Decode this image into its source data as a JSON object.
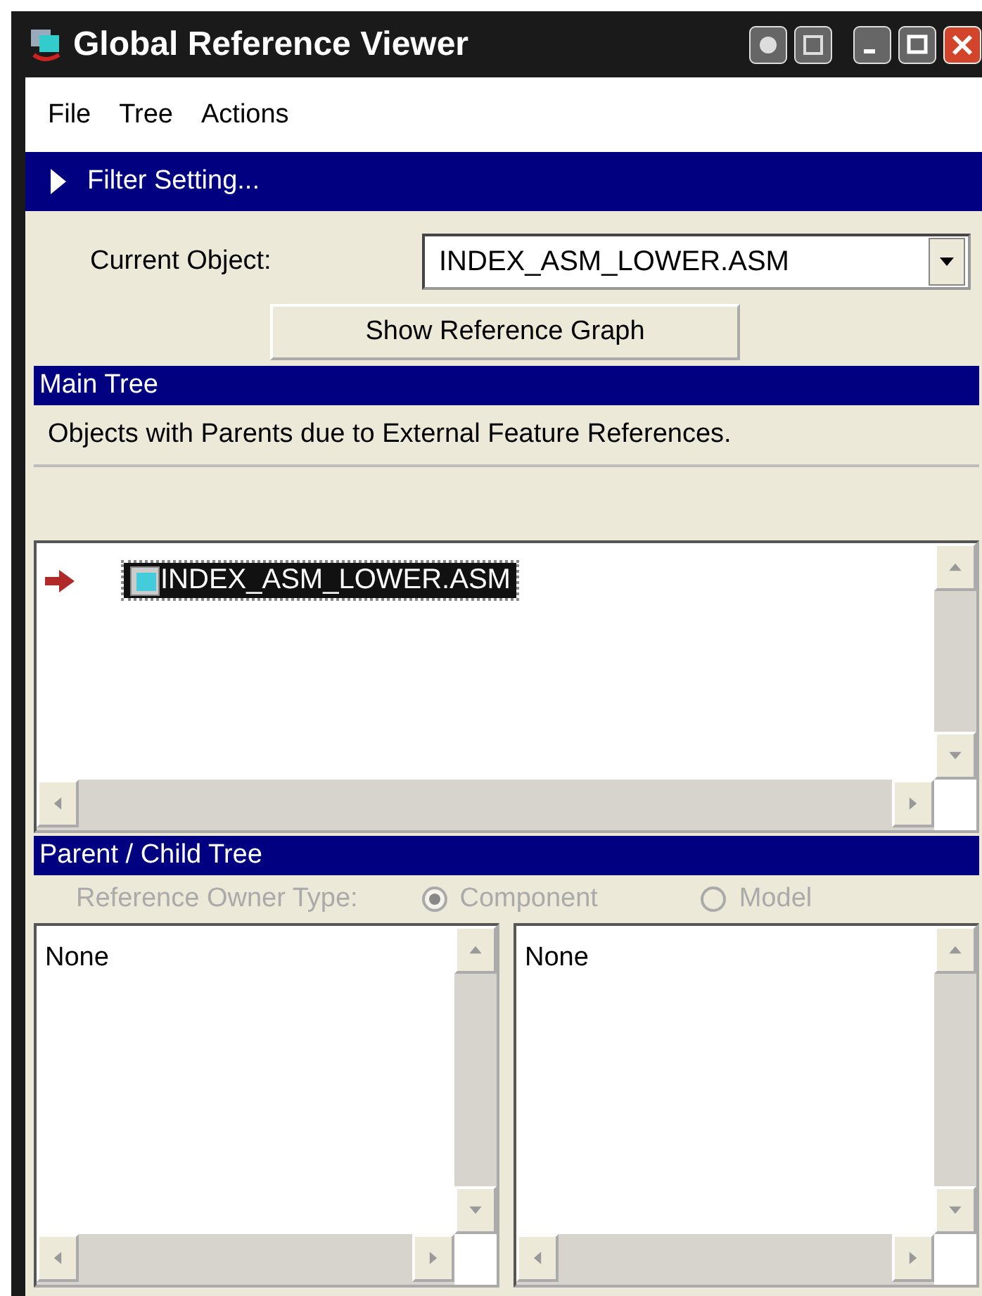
{
  "window": {
    "title": "Global Reference Viewer"
  },
  "menu": [
    "File",
    "Tree",
    "Actions"
  ],
  "filter_bar": {
    "label": "Filter Setting...",
    "expanded": false
  },
  "current_object": {
    "label": "Current Object:",
    "value": "INDEX_ASM_LOWER.ASM"
  },
  "show_graph_button": "Show Reference Graph",
  "main_tree": {
    "title": "Main Tree",
    "description": "Objects with Parents due to External Feature References.",
    "items": [
      {
        "label": "INDEX_ASM_LOWER.ASM",
        "selected": true
      }
    ]
  },
  "parent_child_tree": {
    "title": "Parent / Child Tree",
    "owner_type": {
      "label": "Reference Owner Type:",
      "disabled": true,
      "options": [
        {
          "label": "Component",
          "selected": true
        },
        {
          "label": "Model",
          "selected": false
        }
      ]
    },
    "lists": [
      {
        "items": [
          "None"
        ]
      },
      {
        "items": [
          "None"
        ]
      }
    ]
  }
}
